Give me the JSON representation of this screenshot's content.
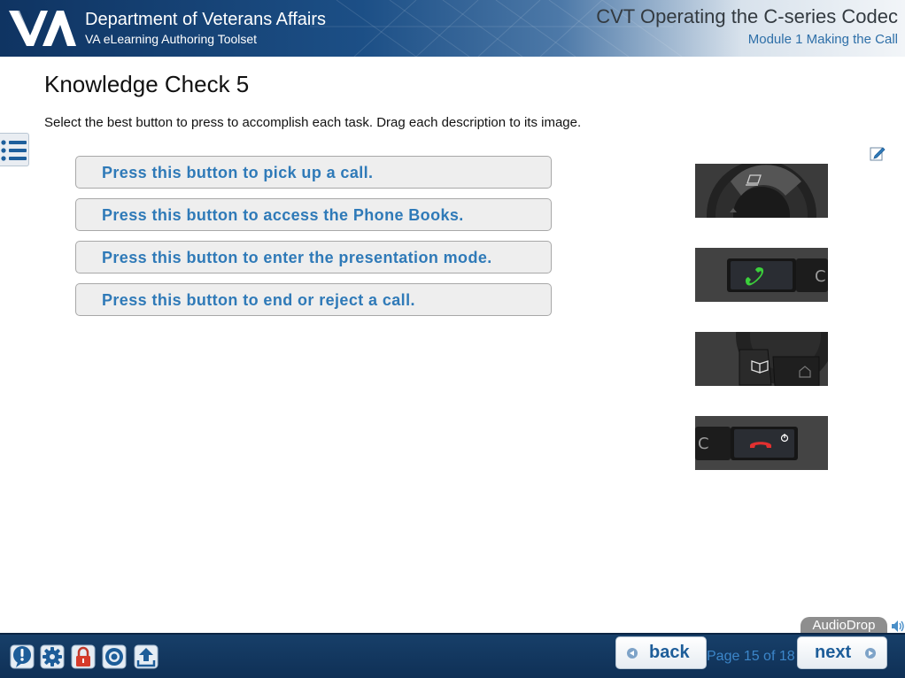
{
  "header": {
    "org_name": "Department of Veterans Affairs",
    "org_sub": "VA eLearning Authoring Toolset",
    "course_title": "CVT Operating the C-series Codec",
    "module_title": "Module 1 Making the Call"
  },
  "content": {
    "page_title": "Knowledge Check 5",
    "instructions": "Select the best button to press to accomplish each task. Drag each description to its image.",
    "drag_items": [
      "Press this button to pick up a call.",
      "Press this button to access the Phone Books.",
      "Press this button to enter the presentation mode.",
      "Press this button to end or reject a call."
    ],
    "targets": [
      {
        "icon": "presentation-button-image",
        "letter": ""
      },
      {
        "icon": "pick-up-call-button-image",
        "letter": "C"
      },
      {
        "icon": "phone-book-button-image",
        "letter": ""
      },
      {
        "icon": "end-call-button-image",
        "letter": "C"
      }
    ]
  },
  "footer": {
    "audiodrop_label": "AudioDrop",
    "back_label": "back",
    "next_label": "next",
    "page_counter": "Page 15 of 18",
    "icons": [
      "help-icon",
      "settings-icon",
      "lock-icon",
      "target-icon",
      "upload-icon"
    ]
  },
  "colors": {
    "header_dark": "#0f3462",
    "accent_blue": "#2f7ab8",
    "footer_bg": "#173f69",
    "call_green": "#3bd03b",
    "end_red": "#e23030"
  }
}
